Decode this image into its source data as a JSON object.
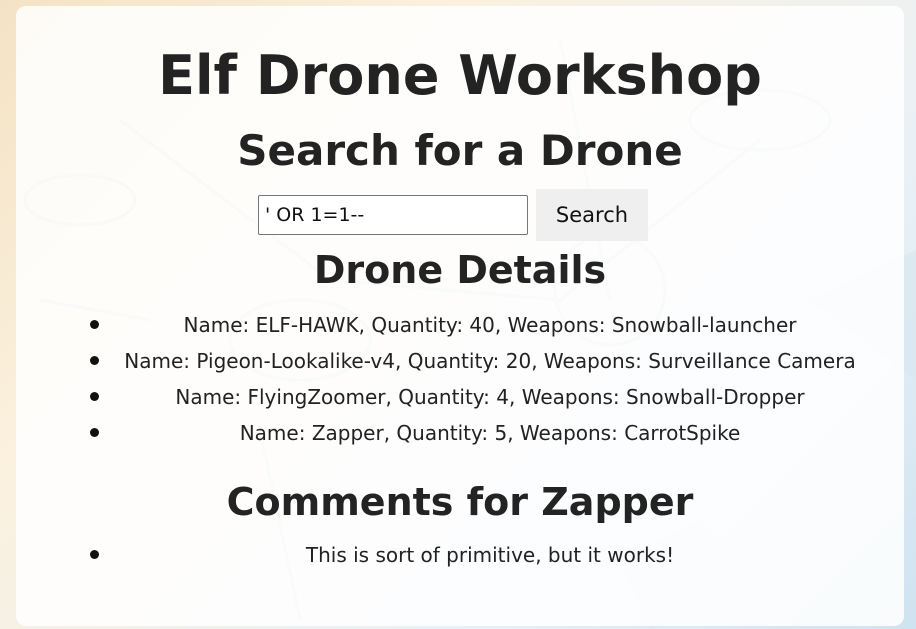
{
  "page": {
    "title": "Elf Drone Workshop",
    "search_heading": "Search for a Drone",
    "details_heading": "Drone Details",
    "comments_heading": "Comments for Zapper"
  },
  "search": {
    "value": "' OR 1=1--",
    "button_label": "Search"
  },
  "drones": [
    {
      "text": "Name: ELF-HAWK, Quantity: 40, Weapons: Snowball-launcher"
    },
    {
      "text": "Name: Pigeon-Lookalike-v4, Quantity: 20, Weapons: Surveillance Camera"
    },
    {
      "text": "Name: FlyingZoomer, Quantity: 4, Weapons: Snowball-Dropper"
    },
    {
      "text": "Name: Zapper, Quantity: 5, Weapons: CarrotSpike"
    }
  ],
  "comments": [
    {
      "text": "This is sort of primitive, but it works!"
    }
  ],
  "colors": {
    "panel": "#ffffff",
    "text": "#222222",
    "button": "#efefef"
  }
}
